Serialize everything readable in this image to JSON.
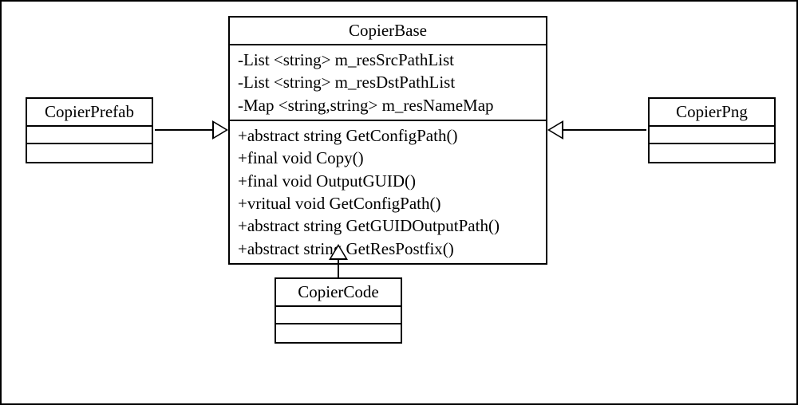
{
  "classes": {
    "copierBase": {
      "name": "CopierBase",
      "attributes": [
        "-List <string> m_resSrcPathList",
        "-List <string> m_resDstPathList",
        "-Map <string,string> m_resNameMap"
      ],
      "operations": [
        "+abstract string GetConfigPath()",
        "+final void Copy()",
        "+final void OutputGUID()",
        "+vritual void GetConfigPath()",
        "+abstract string GetGUIDOutputPath()",
        "+abstract string GetResPostfix()"
      ]
    },
    "copierPrefab": {
      "name": "CopierPrefab",
      "attributes": [],
      "operations": []
    },
    "copierPng": {
      "name": "CopierPng",
      "attributes": [],
      "operations": []
    },
    "copierCode": {
      "name": "CopierCode",
      "attributes": [],
      "operations": []
    }
  },
  "relationships": [
    {
      "from": "copierPrefab",
      "to": "copierBase",
      "type": "generalization"
    },
    {
      "from": "copierPng",
      "to": "copierBase",
      "type": "generalization"
    },
    {
      "from": "copierCode",
      "to": "copierBase",
      "type": "generalization"
    }
  ]
}
